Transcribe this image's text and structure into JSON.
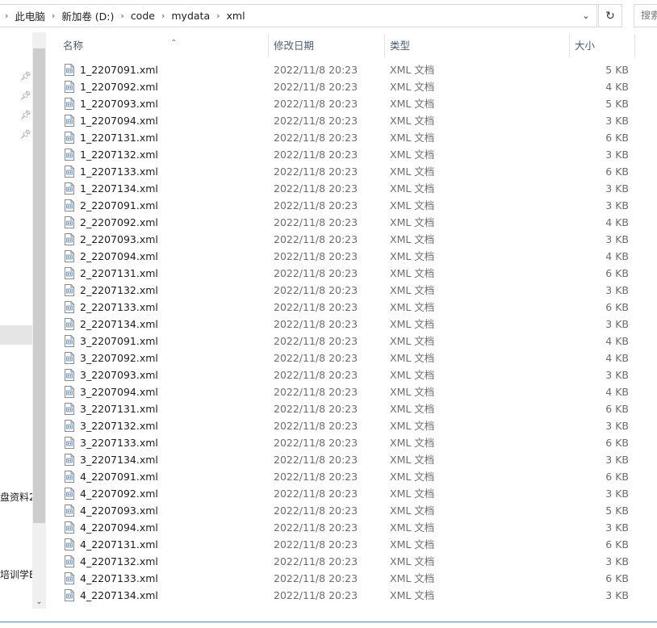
{
  "address": {
    "crumbs": [
      "此电脑",
      "新加卷 (D:)",
      "code",
      "mydata",
      "xml"
    ],
    "search_placeholder": "搜索"
  },
  "nav": {
    "items": [
      "盘资料2",
      "培训学B"
    ]
  },
  "columns": {
    "name": "名称",
    "date": "修改日期",
    "type": "类型",
    "size": "大小"
  },
  "files": [
    {
      "name": "1_2207091.xml",
      "date": "2022/11/8 20:23",
      "type": "XML 文档",
      "size": "5 KB"
    },
    {
      "name": "1_2207092.xml",
      "date": "2022/11/8 20:23",
      "type": "XML 文档",
      "size": "4 KB"
    },
    {
      "name": "1_2207093.xml",
      "date": "2022/11/8 20:23",
      "type": "XML 文档",
      "size": "5 KB"
    },
    {
      "name": "1_2207094.xml",
      "date": "2022/11/8 20:23",
      "type": "XML 文档",
      "size": "3 KB"
    },
    {
      "name": "1_2207131.xml",
      "date": "2022/11/8 20:23",
      "type": "XML 文档",
      "size": "6 KB"
    },
    {
      "name": "1_2207132.xml",
      "date": "2022/11/8 20:23",
      "type": "XML 文档",
      "size": "3 KB"
    },
    {
      "name": "1_2207133.xml",
      "date": "2022/11/8 20:23",
      "type": "XML 文档",
      "size": "6 KB"
    },
    {
      "name": "1_2207134.xml",
      "date": "2022/11/8 20:23",
      "type": "XML 文档",
      "size": "3 KB"
    },
    {
      "name": "2_2207091.xml",
      "date": "2022/11/8 20:23",
      "type": "XML 文档",
      "size": "3 KB"
    },
    {
      "name": "2_2207092.xml",
      "date": "2022/11/8 20:23",
      "type": "XML 文档",
      "size": "4 KB"
    },
    {
      "name": "2_2207093.xml",
      "date": "2022/11/8 20:23",
      "type": "XML 文档",
      "size": "3 KB"
    },
    {
      "name": "2_2207094.xml",
      "date": "2022/11/8 20:23",
      "type": "XML 文档",
      "size": "4 KB"
    },
    {
      "name": "2_2207131.xml",
      "date": "2022/11/8 20:23",
      "type": "XML 文档",
      "size": "6 KB"
    },
    {
      "name": "2_2207132.xml",
      "date": "2022/11/8 20:23",
      "type": "XML 文档",
      "size": "3 KB"
    },
    {
      "name": "2_2207133.xml",
      "date": "2022/11/8 20:23",
      "type": "XML 文档",
      "size": "6 KB"
    },
    {
      "name": "2_2207134.xml",
      "date": "2022/11/8 20:23",
      "type": "XML 文档",
      "size": "3 KB"
    },
    {
      "name": "3_2207091.xml",
      "date": "2022/11/8 20:23",
      "type": "XML 文档",
      "size": "4 KB"
    },
    {
      "name": "3_2207092.xml",
      "date": "2022/11/8 20:23",
      "type": "XML 文档",
      "size": "4 KB"
    },
    {
      "name": "3_2207093.xml",
      "date": "2022/11/8 20:23",
      "type": "XML 文档",
      "size": "3 KB"
    },
    {
      "name": "3_2207094.xml",
      "date": "2022/11/8 20:23",
      "type": "XML 文档",
      "size": "4 KB"
    },
    {
      "name": "3_2207131.xml",
      "date": "2022/11/8 20:23",
      "type": "XML 文档",
      "size": "6 KB"
    },
    {
      "name": "3_2207132.xml",
      "date": "2022/11/8 20:23",
      "type": "XML 文档",
      "size": "3 KB"
    },
    {
      "name": "3_2207133.xml",
      "date": "2022/11/8 20:23",
      "type": "XML 文档",
      "size": "6 KB"
    },
    {
      "name": "3_2207134.xml",
      "date": "2022/11/8 20:23",
      "type": "XML 文档",
      "size": "3 KB"
    },
    {
      "name": "4_2207091.xml",
      "date": "2022/11/8 20:23",
      "type": "XML 文档",
      "size": "6 KB"
    },
    {
      "name": "4_2207092.xml",
      "date": "2022/11/8 20:23",
      "type": "XML 文档",
      "size": "3 KB"
    },
    {
      "name": "4_2207093.xml",
      "date": "2022/11/8 20:23",
      "type": "XML 文档",
      "size": "5 KB"
    },
    {
      "name": "4_2207094.xml",
      "date": "2022/11/8 20:23",
      "type": "XML 文档",
      "size": "3 KB"
    },
    {
      "name": "4_2207131.xml",
      "date": "2022/11/8 20:23",
      "type": "XML 文档",
      "size": "6 KB"
    },
    {
      "name": "4_2207132.xml",
      "date": "2022/11/8 20:23",
      "type": "XML 文档",
      "size": "3 KB"
    },
    {
      "name": "4_2207133.xml",
      "date": "2022/11/8 20:23",
      "type": "XML 文档",
      "size": "6 KB"
    },
    {
      "name": "4_2207134.xml",
      "date": "2022/11/8 20:23",
      "type": "XML 文档",
      "size": "3 KB"
    }
  ]
}
